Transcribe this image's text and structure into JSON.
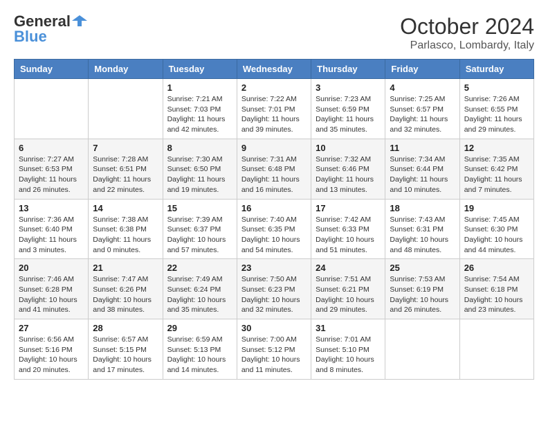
{
  "header": {
    "logo_general": "General",
    "logo_blue": "Blue",
    "month": "October 2024",
    "location": "Parlasco, Lombardy, Italy"
  },
  "calendar": {
    "days_of_week": [
      "Sunday",
      "Monday",
      "Tuesday",
      "Wednesday",
      "Thursday",
      "Friday",
      "Saturday"
    ],
    "weeks": [
      [
        {
          "day": "",
          "info": ""
        },
        {
          "day": "",
          "info": ""
        },
        {
          "day": "1",
          "info": "Sunrise: 7:21 AM\nSunset: 7:03 PM\nDaylight: 11 hours and 42 minutes."
        },
        {
          "day": "2",
          "info": "Sunrise: 7:22 AM\nSunset: 7:01 PM\nDaylight: 11 hours and 39 minutes."
        },
        {
          "day": "3",
          "info": "Sunrise: 7:23 AM\nSunset: 6:59 PM\nDaylight: 11 hours and 35 minutes."
        },
        {
          "day": "4",
          "info": "Sunrise: 7:25 AM\nSunset: 6:57 PM\nDaylight: 11 hours and 32 minutes."
        },
        {
          "day": "5",
          "info": "Sunrise: 7:26 AM\nSunset: 6:55 PM\nDaylight: 11 hours and 29 minutes."
        }
      ],
      [
        {
          "day": "6",
          "info": "Sunrise: 7:27 AM\nSunset: 6:53 PM\nDaylight: 11 hours and 26 minutes."
        },
        {
          "day": "7",
          "info": "Sunrise: 7:28 AM\nSunset: 6:51 PM\nDaylight: 11 hours and 22 minutes."
        },
        {
          "day": "8",
          "info": "Sunrise: 7:30 AM\nSunset: 6:50 PM\nDaylight: 11 hours and 19 minutes."
        },
        {
          "day": "9",
          "info": "Sunrise: 7:31 AM\nSunset: 6:48 PM\nDaylight: 11 hours and 16 minutes."
        },
        {
          "day": "10",
          "info": "Sunrise: 7:32 AM\nSunset: 6:46 PM\nDaylight: 11 hours and 13 minutes."
        },
        {
          "day": "11",
          "info": "Sunrise: 7:34 AM\nSunset: 6:44 PM\nDaylight: 11 hours and 10 minutes."
        },
        {
          "day": "12",
          "info": "Sunrise: 7:35 AM\nSunset: 6:42 PM\nDaylight: 11 hours and 7 minutes."
        }
      ],
      [
        {
          "day": "13",
          "info": "Sunrise: 7:36 AM\nSunset: 6:40 PM\nDaylight: 11 hours and 3 minutes."
        },
        {
          "day": "14",
          "info": "Sunrise: 7:38 AM\nSunset: 6:38 PM\nDaylight: 11 hours and 0 minutes."
        },
        {
          "day": "15",
          "info": "Sunrise: 7:39 AM\nSunset: 6:37 PM\nDaylight: 10 hours and 57 minutes."
        },
        {
          "day": "16",
          "info": "Sunrise: 7:40 AM\nSunset: 6:35 PM\nDaylight: 10 hours and 54 minutes."
        },
        {
          "day": "17",
          "info": "Sunrise: 7:42 AM\nSunset: 6:33 PM\nDaylight: 10 hours and 51 minutes."
        },
        {
          "day": "18",
          "info": "Sunrise: 7:43 AM\nSunset: 6:31 PM\nDaylight: 10 hours and 48 minutes."
        },
        {
          "day": "19",
          "info": "Sunrise: 7:45 AM\nSunset: 6:30 PM\nDaylight: 10 hours and 44 minutes."
        }
      ],
      [
        {
          "day": "20",
          "info": "Sunrise: 7:46 AM\nSunset: 6:28 PM\nDaylight: 10 hours and 41 minutes."
        },
        {
          "day": "21",
          "info": "Sunrise: 7:47 AM\nSunset: 6:26 PM\nDaylight: 10 hours and 38 minutes."
        },
        {
          "day": "22",
          "info": "Sunrise: 7:49 AM\nSunset: 6:24 PM\nDaylight: 10 hours and 35 minutes."
        },
        {
          "day": "23",
          "info": "Sunrise: 7:50 AM\nSunset: 6:23 PM\nDaylight: 10 hours and 32 minutes."
        },
        {
          "day": "24",
          "info": "Sunrise: 7:51 AM\nSunset: 6:21 PM\nDaylight: 10 hours and 29 minutes."
        },
        {
          "day": "25",
          "info": "Sunrise: 7:53 AM\nSunset: 6:19 PM\nDaylight: 10 hours and 26 minutes."
        },
        {
          "day": "26",
          "info": "Sunrise: 7:54 AM\nSunset: 6:18 PM\nDaylight: 10 hours and 23 minutes."
        }
      ],
      [
        {
          "day": "27",
          "info": "Sunrise: 6:56 AM\nSunset: 5:16 PM\nDaylight: 10 hours and 20 minutes."
        },
        {
          "day": "28",
          "info": "Sunrise: 6:57 AM\nSunset: 5:15 PM\nDaylight: 10 hours and 17 minutes."
        },
        {
          "day": "29",
          "info": "Sunrise: 6:59 AM\nSunset: 5:13 PM\nDaylight: 10 hours and 14 minutes."
        },
        {
          "day": "30",
          "info": "Sunrise: 7:00 AM\nSunset: 5:12 PM\nDaylight: 10 hours and 11 minutes."
        },
        {
          "day": "31",
          "info": "Sunrise: 7:01 AM\nSunset: 5:10 PM\nDaylight: 10 hours and 8 minutes."
        },
        {
          "day": "",
          "info": ""
        },
        {
          "day": "",
          "info": ""
        }
      ]
    ]
  }
}
